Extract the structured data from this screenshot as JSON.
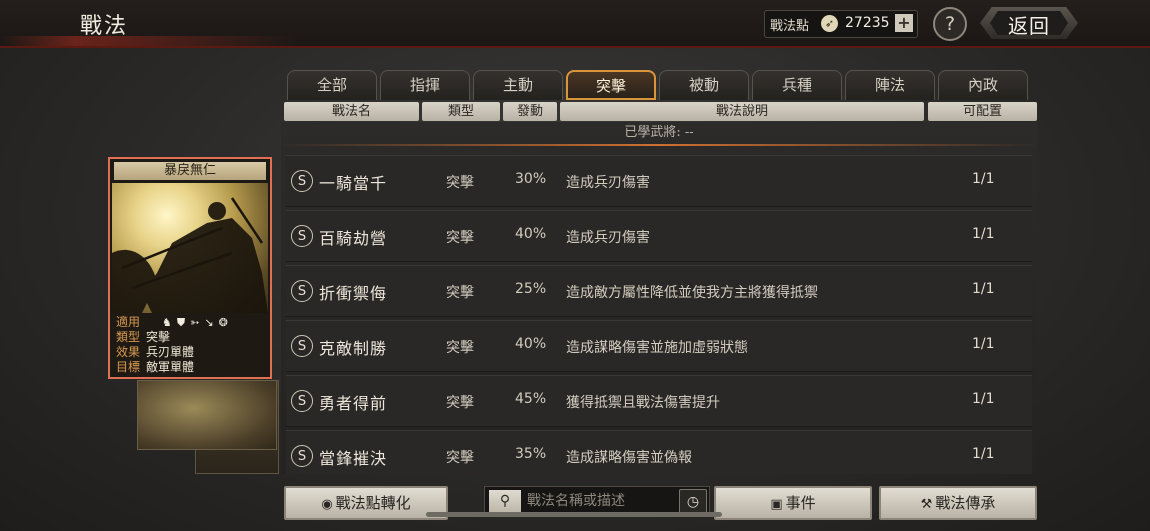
{
  "header": {
    "title": "戰法",
    "points_label": "戰法點",
    "points_icon": "compass-coin-icon",
    "points_value": "27235",
    "plus_label": "+",
    "help_label": "?",
    "back_label": "返回"
  },
  "tabs": [
    "全部",
    "指揮",
    "主動",
    "突擊",
    "被動",
    "兵種",
    "陣法",
    "內政"
  ],
  "active_tab": "突擊",
  "columns": [
    "戰法名",
    "類型",
    "發動",
    "戰法說明",
    "可配置"
  ],
  "learned_text": "已學武將: --",
  "rows": [
    {
      "grade": "S",
      "name": "一騎當千",
      "type": "突擊",
      "rate": "30%",
      "desc": "造成兵刃傷害",
      "slots": "1/1"
    },
    {
      "grade": "S",
      "name": "百騎劫營",
      "type": "突擊",
      "rate": "40%",
      "desc": "造成兵刃傷害",
      "slots": "1/1"
    },
    {
      "grade": "S",
      "name": "折衝禦侮",
      "type": "突擊",
      "rate": "25%",
      "desc": "造成敵方屬性降低並使我方主將獲得抵禦",
      "slots": "1/1"
    },
    {
      "grade": "S",
      "name": "克敵制勝",
      "type": "突擊",
      "rate": "40%",
      "desc": "造成謀略傷害並施加虛弱狀態",
      "slots": "1/1"
    },
    {
      "grade": "S",
      "name": "勇者得前",
      "type": "突擊",
      "rate": "45%",
      "desc": "獲得抵禦且戰法傷害提升",
      "slots": "1/1"
    },
    {
      "grade": "S",
      "name": "當鋒摧決",
      "type": "突擊",
      "rate": "35%",
      "desc": "造成謀略傷害並偽報",
      "slots": "1/1"
    }
  ],
  "card": {
    "title": "暴戾無仁",
    "applicable_label": "適用",
    "applicable_icons": [
      "cavalry-icon",
      "shield-icon",
      "bow-icon",
      "spear-icon",
      "wheel-icon"
    ],
    "type_label": "類型",
    "type_value": "突擊",
    "effect_label": "效果",
    "effect_value": "兵刃單體",
    "target_label": "目標",
    "target_value": "敵軍單體"
  },
  "bottom": {
    "convert_label": "戰法點轉化",
    "search_placeholder": "戰法名稱或描述",
    "event_label": "事件",
    "inherit_label": "戰法傳承"
  },
  "colors": {
    "accent_tab": "#d8953a",
    "card_border": "#e07050",
    "header_red": "#5a1a12"
  }
}
